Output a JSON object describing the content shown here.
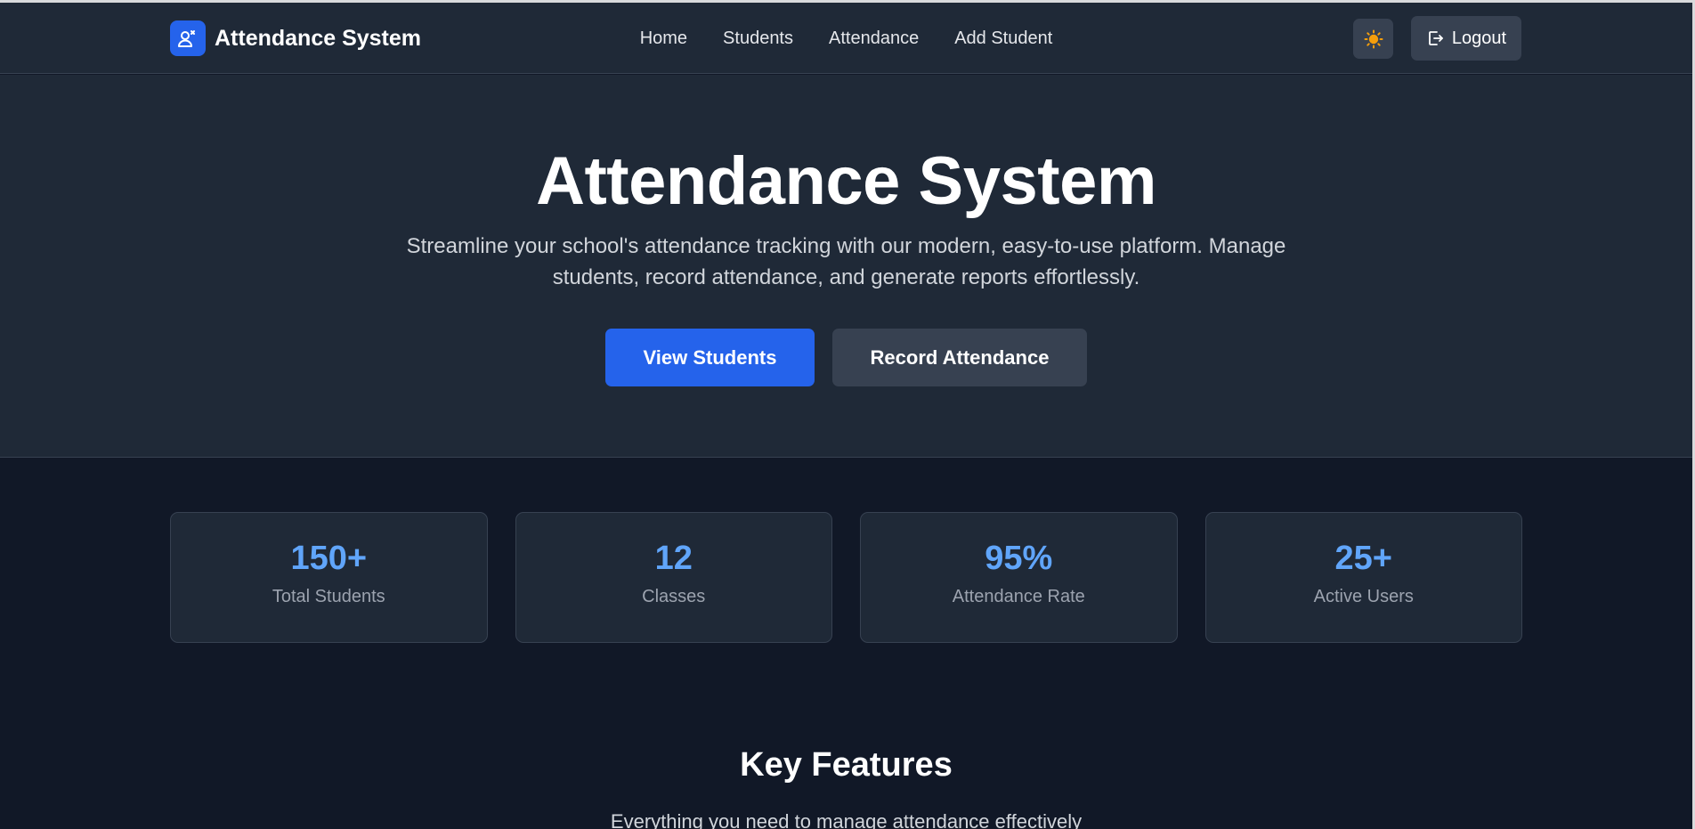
{
  "brand": {
    "title": "Attendance System",
    "icon": "user-check-icon"
  },
  "nav": {
    "links": [
      "Home",
      "Students",
      "Attendance",
      "Add Student"
    ],
    "theme_icon": "sun-icon",
    "logout_label": "Logout",
    "logout_icon": "logout-icon"
  },
  "hero": {
    "title": "Attendance System",
    "description": "Streamline your school's attendance tracking with our modern, easy-to-use platform. Manage students, record attendance, and generate reports effortlessly.",
    "primary_button": "View Students",
    "secondary_button": "Record Attendance"
  },
  "stats": [
    {
      "value": "150+",
      "label": "Total Students"
    },
    {
      "value": "12",
      "label": "Classes"
    },
    {
      "value": "95%",
      "label": "Attendance Rate"
    },
    {
      "value": "25+",
      "label": "Active Users"
    }
  ],
  "features": {
    "title": "Key Features",
    "subtitle": "Everything you need to manage attendance effectively"
  },
  "colors": {
    "accent": "#2563eb",
    "stat_value": "#60a5fa",
    "sun": "#f59e0b",
    "bg_dark": "#111827",
    "bg_panel": "#1f2937"
  }
}
